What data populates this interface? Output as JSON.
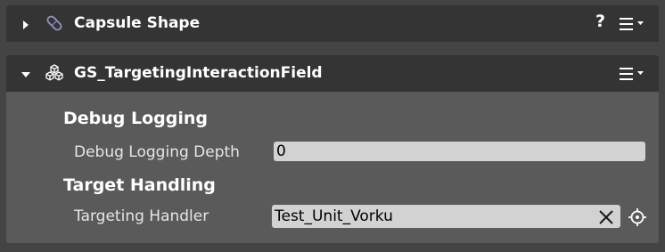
{
  "components": [
    {
      "title": "Capsule Shape",
      "expanded": false,
      "icon": "capsule-icon",
      "help_label": "?",
      "menu_icon": "menu-icon"
    },
    {
      "title": "GS_TargetingInteractionField",
      "expanded": true,
      "icon": "component-cubes-icon",
      "menu_icon": "menu-icon",
      "groups": [
        {
          "heading": "Debug Logging",
          "properties": [
            {
              "label": "Debug Logging Depth",
              "value": "0"
            }
          ]
        },
        {
          "heading": "Target Handling",
          "properties": [
            {
              "label": "Targeting Handler",
              "value": "Test_Unit_Vorku"
            }
          ]
        }
      ]
    }
  ],
  "colors": {
    "background": "#444444",
    "header": "#343434",
    "body": "#5a5a5a",
    "field": "#d2d2d2"
  }
}
